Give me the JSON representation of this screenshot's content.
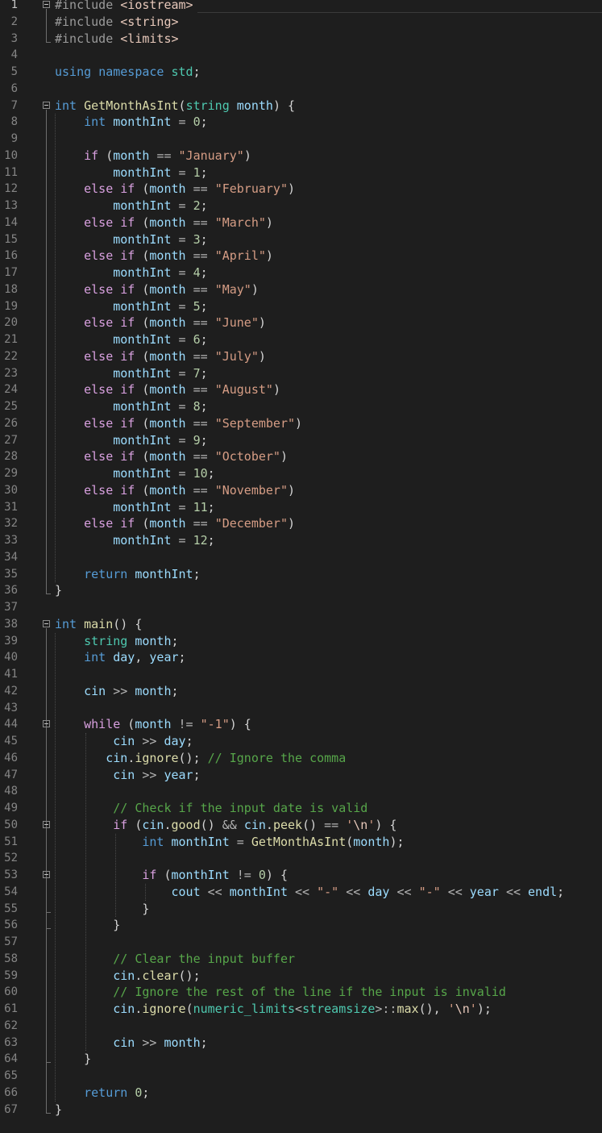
{
  "editor": {
    "language": "C++",
    "colors": {
      "background": "#1e1e1e",
      "keyword": "#569cd6",
      "control": "#d8a0df",
      "string": "#d69d85",
      "number": "#b5cea8",
      "function": "#dcdcaa",
      "variable": "#9cdcfe",
      "type": "#4ec9b0",
      "comment": "#57a64a",
      "line_number": "#858585"
    },
    "active_line": 1,
    "fold_markers": [
      1,
      7,
      38,
      44,
      50,
      53
    ],
    "lines": [
      {
        "n": "1",
        "text": "#include <iostream>"
      },
      {
        "n": "2",
        "text": "#include <string>"
      },
      {
        "n": "3",
        "text": "#include <limits>"
      },
      {
        "n": "4",
        "text": ""
      },
      {
        "n": "5",
        "text": "using namespace std;"
      },
      {
        "n": "6",
        "text": ""
      },
      {
        "n": "7",
        "text": "int GetMonthAsInt(string month) {"
      },
      {
        "n": "8",
        "text": "    int monthInt = 0;"
      },
      {
        "n": "9",
        "text": ""
      },
      {
        "n": "10",
        "text": "    if (month == \"January\")"
      },
      {
        "n": "11",
        "text": "        monthInt = 1;"
      },
      {
        "n": "12",
        "text": "    else if (month == \"February\")"
      },
      {
        "n": "13",
        "text": "        monthInt = 2;"
      },
      {
        "n": "14",
        "text": "    else if (month == \"March\")"
      },
      {
        "n": "15",
        "text": "        monthInt = 3;"
      },
      {
        "n": "16",
        "text": "    else if (month == \"April\")"
      },
      {
        "n": "17",
        "text": "        monthInt = 4;"
      },
      {
        "n": "18",
        "text": "    else if (month == \"May\")"
      },
      {
        "n": "19",
        "text": "        monthInt = 5;"
      },
      {
        "n": "20",
        "text": "    else if (month == \"June\")"
      },
      {
        "n": "21",
        "text": "        monthInt = 6;"
      },
      {
        "n": "22",
        "text": "    else if (month == \"July\")"
      },
      {
        "n": "23",
        "text": "        monthInt = 7;"
      },
      {
        "n": "24",
        "text": "    else if (month == \"August\")"
      },
      {
        "n": "25",
        "text": "        monthInt = 8;"
      },
      {
        "n": "26",
        "text": "    else if (month == \"September\")"
      },
      {
        "n": "27",
        "text": "        monthInt = 9;"
      },
      {
        "n": "28",
        "text": "    else if (month == \"October\")"
      },
      {
        "n": "29",
        "text": "        monthInt = 10;"
      },
      {
        "n": "30",
        "text": "    else if (month == \"November\")"
      },
      {
        "n": "31",
        "text": "        monthInt = 11;"
      },
      {
        "n": "32",
        "text": "    else if (month == \"December\")"
      },
      {
        "n": "33",
        "text": "        monthInt = 12;"
      },
      {
        "n": "34",
        "text": ""
      },
      {
        "n": "35",
        "text": "    return monthInt;"
      },
      {
        "n": "36",
        "text": "}"
      },
      {
        "n": "37",
        "text": ""
      },
      {
        "n": "38",
        "text": "int main() {"
      },
      {
        "n": "39",
        "text": "    string month;"
      },
      {
        "n": "40",
        "text": "    int day, year;"
      },
      {
        "n": "41",
        "text": ""
      },
      {
        "n": "42",
        "text": "    cin >> month;"
      },
      {
        "n": "43",
        "text": ""
      },
      {
        "n": "44",
        "text": "    while (month != \"-1\") {"
      },
      {
        "n": "45",
        "text": "        cin >> day;"
      },
      {
        "n": "46",
        "text": "       cin.ignore(); // Ignore the comma"
      },
      {
        "n": "47",
        "text": "        cin >> year;"
      },
      {
        "n": "48",
        "text": ""
      },
      {
        "n": "49",
        "text": "        // Check if the input date is valid"
      },
      {
        "n": "50",
        "text": "        if (cin.good() && cin.peek() == '\\n') {"
      },
      {
        "n": "51",
        "text": "            int monthInt = GetMonthAsInt(month);"
      },
      {
        "n": "52",
        "text": ""
      },
      {
        "n": "53",
        "text": "            if (monthInt != 0) {"
      },
      {
        "n": "54",
        "text": "                cout << monthInt << \"-\" << day << \"-\" << year << endl;"
      },
      {
        "n": "55",
        "text": "            }"
      },
      {
        "n": "56",
        "text": "        }"
      },
      {
        "n": "57",
        "text": ""
      },
      {
        "n": "58",
        "text": "        // Clear the input buffer"
      },
      {
        "n": "59",
        "text": "        cin.clear();"
      },
      {
        "n": "60",
        "text": "        // Ignore the rest of the line if the input is invalid"
      },
      {
        "n": "61",
        "text": "        cin.ignore(numeric_limits<streamsize>::max(), '\\n');"
      },
      {
        "n": "62",
        "text": ""
      },
      {
        "n": "63",
        "text": "        cin >> month;"
      },
      {
        "n": "64",
        "text": "    }"
      },
      {
        "n": "65",
        "text": ""
      },
      {
        "n": "66",
        "text": "    return 0;"
      },
      {
        "n": "67",
        "text": "}"
      }
    ]
  }
}
